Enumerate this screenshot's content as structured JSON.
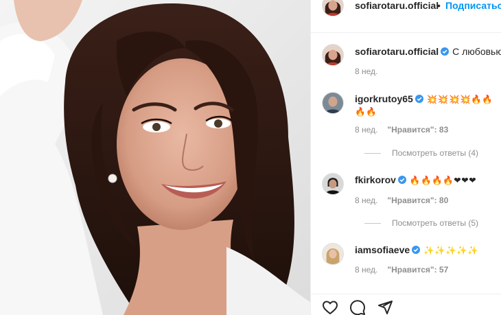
{
  "post": {
    "author": "sofiarotaru.official",
    "separator": "•",
    "follow_label": "Подписаться",
    "photo_alt": "portrait"
  },
  "caption": {
    "username": "sofiarotaru.official",
    "text": "С любовью ❤",
    "time": "8 нед."
  },
  "comments": [
    {
      "username": "igorkrutoy65",
      "verified": true,
      "text_line1": "💥💥💥💥🔥🔥",
      "text_line2": "🔥🔥",
      "time": "8 нед.",
      "likes": "\"Нравится\": 83",
      "replies": "Посмотреть ответы (4)"
    },
    {
      "username": "fkirkorov",
      "verified": true,
      "text_line1": "🔥🔥🔥🔥❤❤❤",
      "time": "8 нед.",
      "likes": "\"Нравится\": 80",
      "replies": "Посмотреть ответы (5)"
    },
    {
      "username": "iamsofiaeve",
      "verified": true,
      "text_line1": "✨✨✨✨✨",
      "time": "8 нед.",
      "likes": "\"Нравится\": 57"
    }
  ],
  "icons": {
    "like": "heart-icon",
    "comment": "comment-bubble-icon",
    "share": "paper-plane-icon",
    "verified": "verified-badge-icon"
  },
  "colors": {
    "link_blue": "#0095f6",
    "verified_blue": "#3897f0",
    "muted_text": "#8e8e8e"
  }
}
